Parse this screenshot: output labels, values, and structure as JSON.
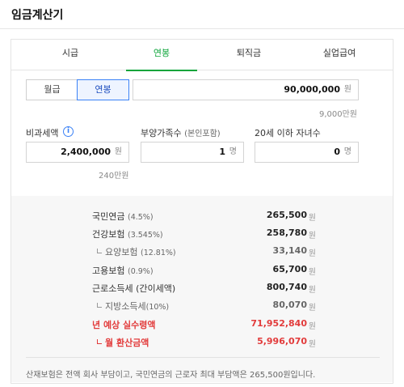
{
  "header": {
    "title": "임금계산기"
  },
  "tabs": [
    {
      "label": "시급"
    },
    {
      "label": "연봉"
    },
    {
      "label": "퇴직금"
    },
    {
      "label": "실업급여"
    }
  ],
  "pay_type": {
    "options": [
      "월급",
      "연봉"
    ],
    "selected": "연봉"
  },
  "salary": {
    "value": "90,000,000",
    "unit": "원",
    "sub": "9,000만원"
  },
  "nontax": {
    "label": "비과세액",
    "value": "2,400,000",
    "unit": "원",
    "sub": "240만원"
  },
  "dependents": {
    "label": "부양가족수",
    "paren": "(본인포함)",
    "value": "1",
    "unit": "명"
  },
  "children": {
    "label": "20세 이하 자녀수",
    "value": "0",
    "unit": "명"
  },
  "results": [
    {
      "label": "국민연금",
      "paren": "(4.5%)",
      "value": "265,500",
      "unit": "원"
    },
    {
      "label": "건강보험",
      "paren": "(3.545%)",
      "value": "258,780",
      "unit": "원"
    },
    {
      "label": "요양보험",
      "paren": "(12.81%)",
      "value": "33,140",
      "unit": "원"
    },
    {
      "label": "고용보험",
      "paren": "(0.9%)",
      "value": "65,700",
      "unit": "원"
    },
    {
      "label": "근로소득세",
      "paren": "(간이세액)",
      "value": "800,740",
      "unit": "원"
    },
    {
      "label": "지방소득세",
      "paren": "(10%)",
      "value": "80,070",
      "unit": "원"
    },
    {
      "label": "년 예상 실수령액",
      "paren": "",
      "value": "71,952,840",
      "unit": "원"
    },
    {
      "label": "월 환산금액",
      "paren": "",
      "value": "5,996,070",
      "unit": "원"
    }
  ],
  "note": "산재보험은 전액 회사 부담이고, 국민연금의 근로자 최대 부담액은 265,500원입니다.",
  "colors": {
    "accent_green": "#0ca43a",
    "accent_blue": "#3b82f6",
    "highlight_red": "#e23b3b"
  }
}
